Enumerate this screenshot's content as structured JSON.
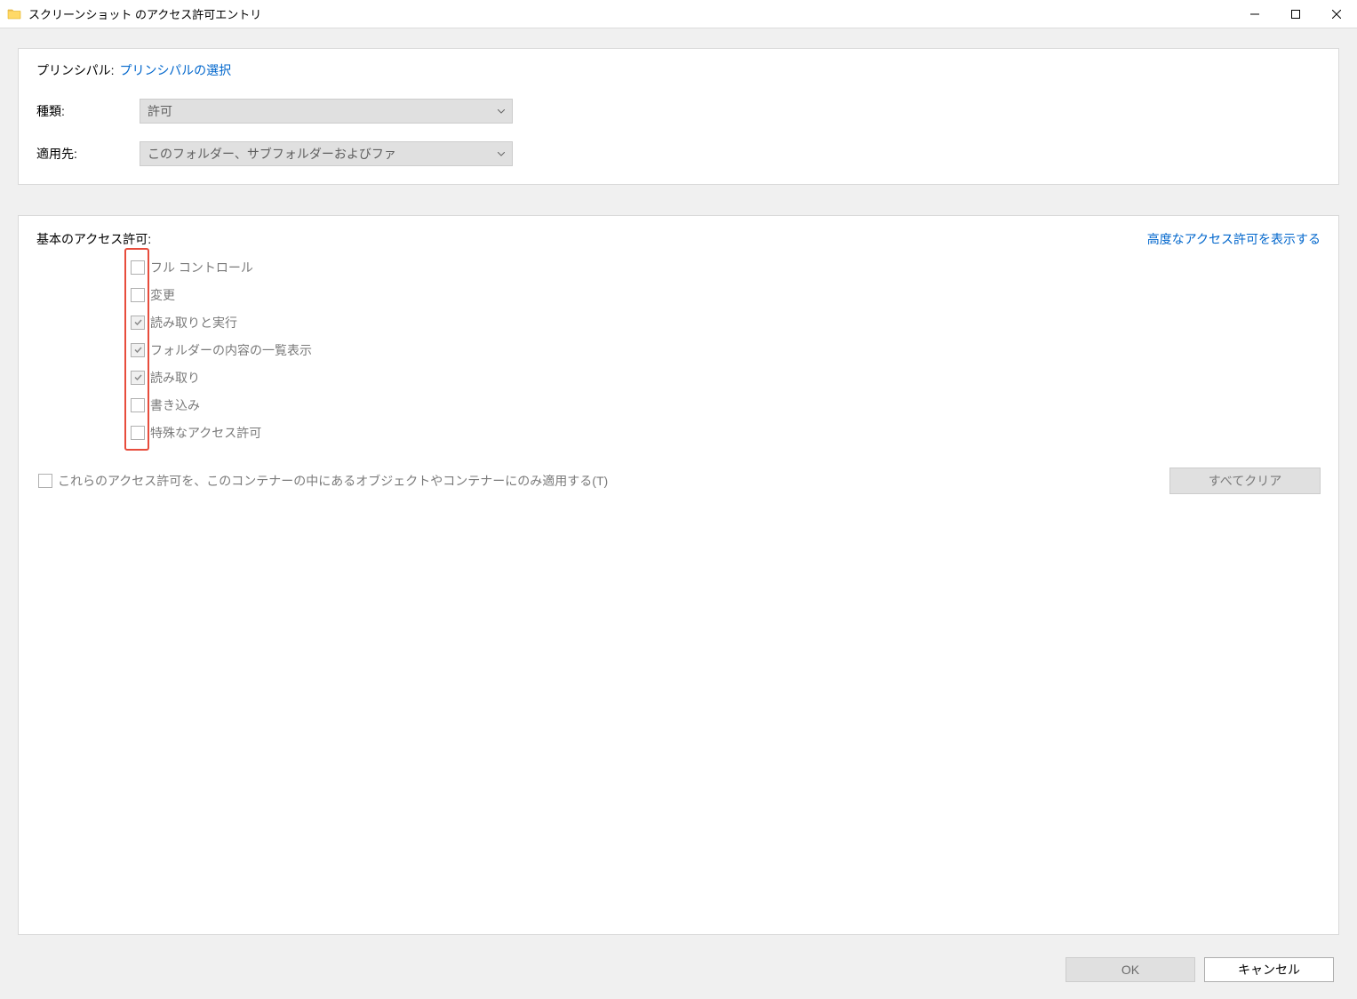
{
  "titleBar": {
    "title": "スクリーンショット のアクセス許可エントリ"
  },
  "principal": {
    "label": "プリンシパル:",
    "linkText": "プリンシパルの選択"
  },
  "type": {
    "label": "種類:",
    "value": "許可"
  },
  "appliesTo": {
    "label": "適用先:",
    "value": "このフォルダー、サブフォルダーおよびファ"
  },
  "basicPermissions": {
    "label": "基本のアクセス許可:",
    "advancedLink": "高度なアクセス許可を表示する",
    "items": [
      {
        "label": "フル コントロール",
        "checked": false
      },
      {
        "label": "変更",
        "checked": false
      },
      {
        "label": "読み取りと実行",
        "checked": true
      },
      {
        "label": "フォルダーの内容の一覧表示",
        "checked": true
      },
      {
        "label": "読み取り",
        "checked": true
      },
      {
        "label": "書き込み",
        "checked": false
      },
      {
        "label": "特殊なアクセス許可",
        "checked": false
      }
    ]
  },
  "applyOnly": {
    "label": "これらのアクセス許可を、このコンテナーの中にあるオブジェクトやコンテナーにのみ適用する(T)"
  },
  "clearAllBtn": "すべてクリア",
  "footer": {
    "ok": "OK",
    "cancel": "キャンセル"
  }
}
